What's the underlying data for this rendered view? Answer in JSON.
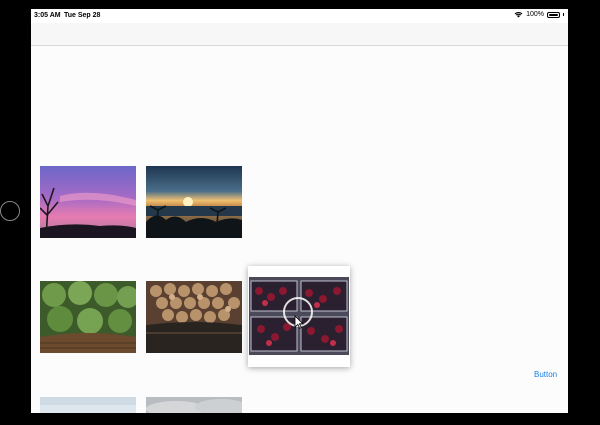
{
  "status_bar": {
    "time": "3:05 AM",
    "date": "Tue Sep 28",
    "battery": "100%",
    "icons": [
      "wifi-icon",
      "battery-icon"
    ]
  },
  "photos": [
    {
      "subject": "purple-sunset-tree"
    },
    {
      "subject": "ocean-sunset-palms"
    },
    {
      "subject": "artichokes-basket"
    },
    {
      "subject": "walnuts-basket"
    },
    {
      "subject": "cherries-boxes",
      "state": "dragging"
    },
    {
      "subject": "sky-partial"
    },
    {
      "subject": "clouds-partial"
    }
  ],
  "action_button": {
    "label": "Button"
  },
  "colors": {
    "accent": "#1a7fe5",
    "background": "#fcfcfd",
    "navbar": "#f7f7f8"
  }
}
